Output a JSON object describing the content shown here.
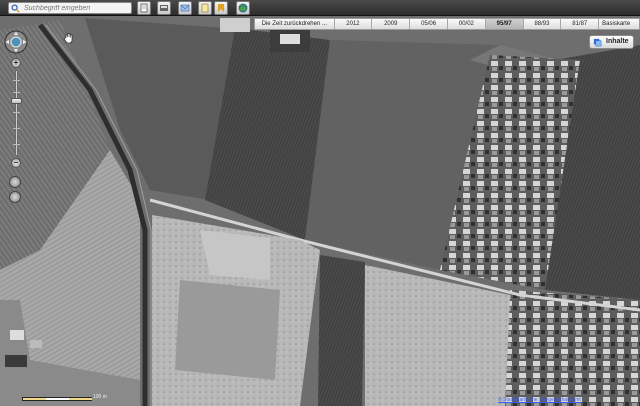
{
  "search": {
    "placeholder": "Suchbegriff eingeben"
  },
  "toolbar": {
    "buttons": [
      {
        "name": "print-icon"
      },
      {
        "name": "save-icon"
      },
      {
        "name": "mail-icon"
      },
      {
        "name": "document-icon"
      },
      {
        "name": "bookmark-icon"
      },
      {
        "name": "globe-icon"
      }
    ]
  },
  "timeline": {
    "label": "Die Zeit zurückdrehen ...",
    "years": [
      "2012",
      "2009",
      "05/06",
      "00/02",
      "95/97",
      "88/93",
      "81/87"
    ],
    "selected": "95/97",
    "basis_label": "Basiskarte"
  },
  "contents": {
    "label": "Inhalte"
  },
  "map": {
    "scale_label": "100 m"
  },
  "footer": {
    "copyright": "© Stadt Karlsruhe | Liegenschaftsamt"
  },
  "colors": {
    "accent": "#3a5cff",
    "toolbar": "#2c2c2c"
  }
}
